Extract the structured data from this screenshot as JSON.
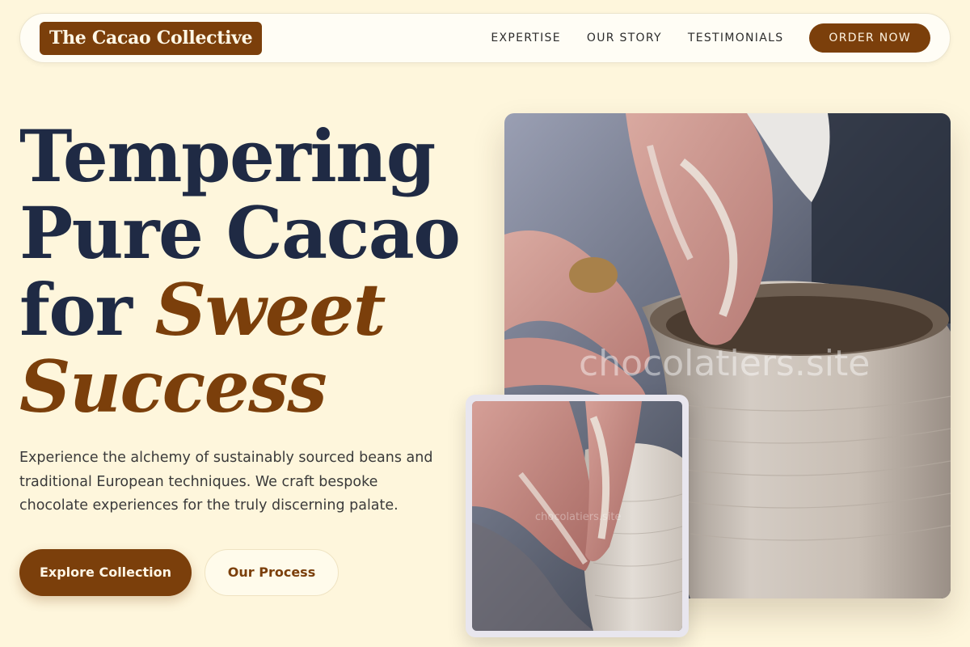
{
  "nav": {
    "logo": "The Cacao Collective",
    "links": [
      "Expertise",
      "Our Story",
      "Testimonials"
    ],
    "cta": "Order Now"
  },
  "hero": {
    "headline_1": "Tempering",
    "headline_2": "Pure Cacao",
    "headline_3_plain": "for ",
    "headline_3_accent": "Sweet",
    "headline_4_accent": "Success",
    "description": "Experience the alchemy of sustainably sourced beans and traditional European techniques. We craft bespoke chocolate experiences for the truly discerning palate.",
    "primary_button": "Explore Collection",
    "secondary_button": "Our Process"
  },
  "images": {
    "main_watermark": "chocolatiers.site",
    "inset_watermark": "chocolatiers.site"
  },
  "colors": {
    "background": "#fef6dc",
    "brand_brown": "#7b3f0b",
    "navy_text": "#1f2a44"
  }
}
